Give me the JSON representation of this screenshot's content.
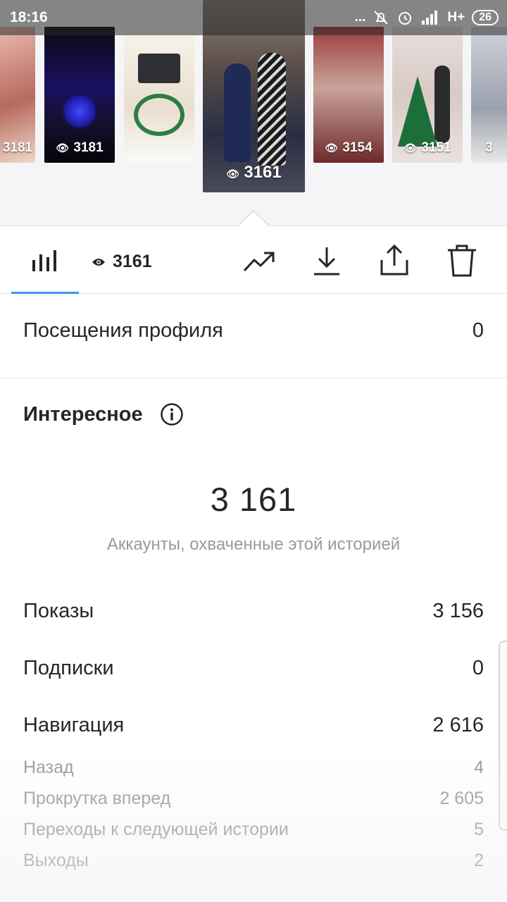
{
  "status_bar": {
    "time": "18:16",
    "dots": "...",
    "network": "H+",
    "battery": "26"
  },
  "stories": [
    {
      "views": "3181",
      "partial": true
    },
    {
      "views": "3181"
    },
    {
      "views": ""
    },
    {
      "views": "3161",
      "selected": true
    },
    {
      "views": "3154"
    },
    {
      "views": "3151"
    },
    {
      "views": "3",
      "partial": true
    }
  ],
  "toolbar": {
    "views_count": "3161",
    "icons": [
      "bar-chart-icon",
      "eye-icon",
      "trending-icon",
      "download-icon",
      "share-icon",
      "trash-icon"
    ],
    "accent_color": "#3897f0"
  },
  "profile_visits": {
    "label": "Посещения профиля",
    "value": "0"
  },
  "discovery": {
    "title": "Интересное",
    "reach_value": "3 161",
    "reach_caption": "Аккаунты, охваченные этой историей"
  },
  "metrics": [
    {
      "label": "Показы",
      "value": "3 156"
    },
    {
      "label": "Подписки",
      "value": "0"
    },
    {
      "label": "Навигация",
      "value": "2 616"
    }
  ],
  "navigation_details": [
    {
      "label": "Назад",
      "value": "4"
    },
    {
      "label": "Прокрутка вперед",
      "value": "2 605"
    },
    {
      "label": "Переходы к следующей истории",
      "value": "5"
    },
    {
      "label": "Выходы",
      "value": "2"
    }
  ]
}
